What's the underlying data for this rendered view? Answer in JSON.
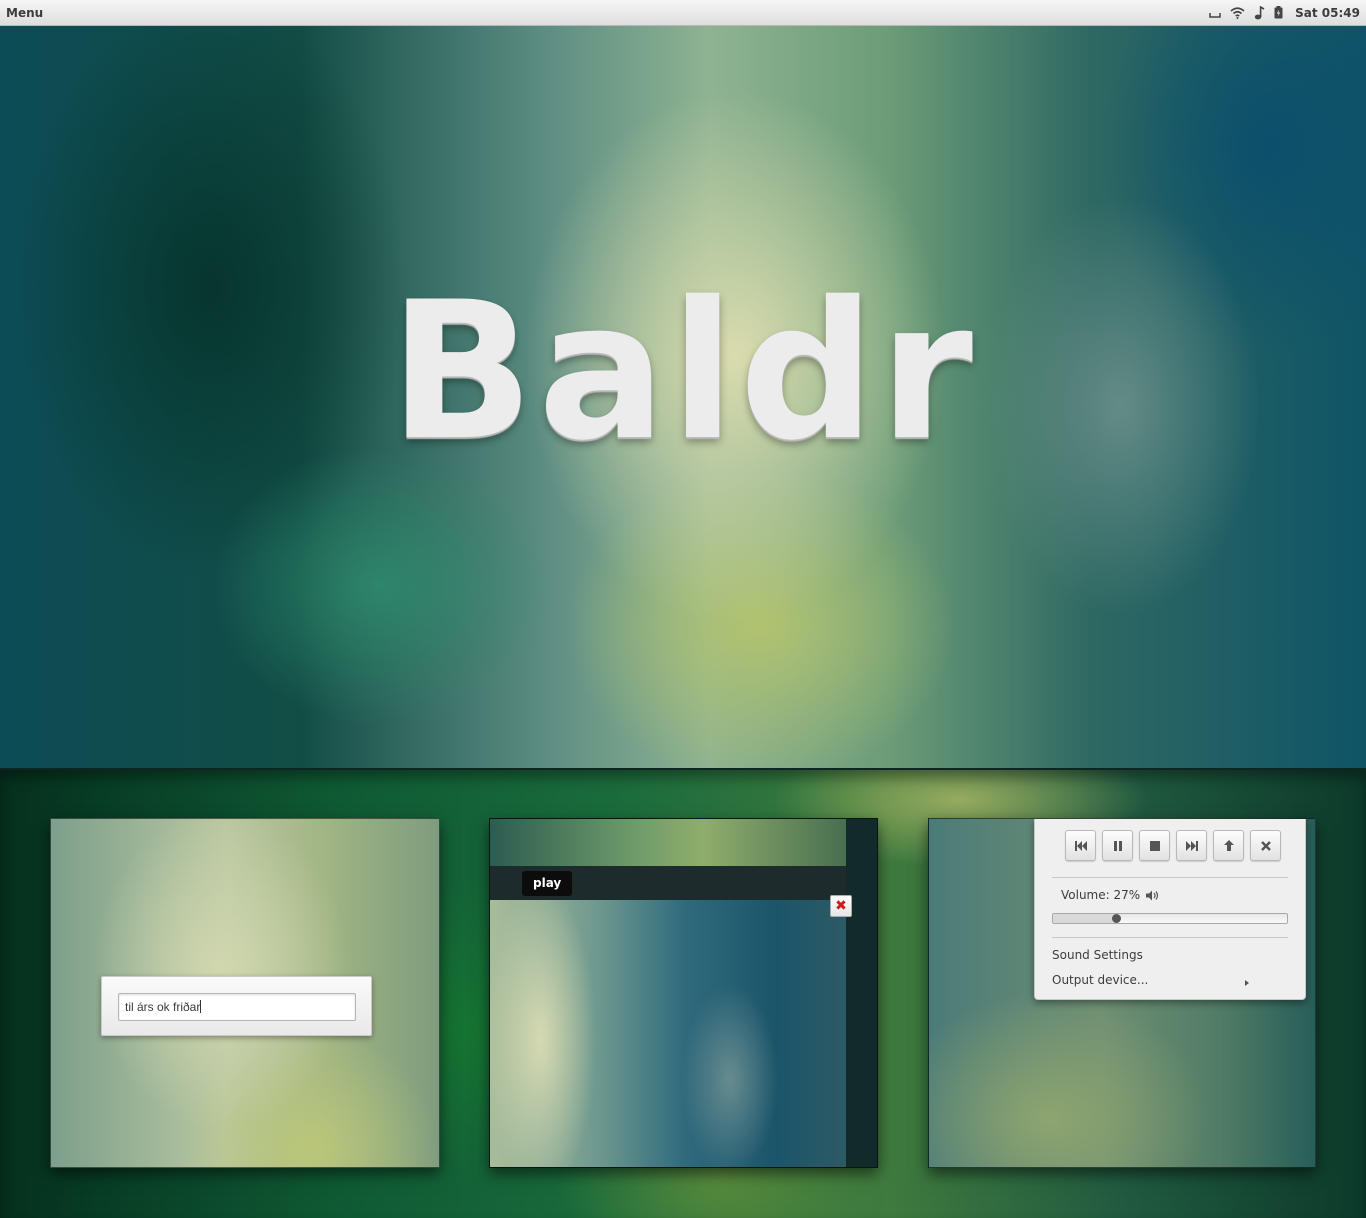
{
  "panel": {
    "menu_label": "Menu",
    "clock": "Sat 05:49",
    "tray_icons": [
      "keyboard-icon",
      "wifi-icon",
      "music-note-icon",
      "battery-icon"
    ]
  },
  "hero": {
    "title": "Baldr"
  },
  "thumb_dialog": {
    "input_value": "til árs ok friðar"
  },
  "thumb_player": {
    "play_label": "play",
    "close_glyph": "✖"
  },
  "sound_menu": {
    "buttons": [
      "previous-icon",
      "pause-icon",
      "stop-icon",
      "next-icon",
      "eject-icon",
      "close-icon"
    ],
    "volume_label": "Volume: 27%",
    "volume_level": 0.27,
    "sound_settings": "Sound Settings",
    "output_device": "Output device..."
  },
  "colors": {
    "panel_bg": "#e9e9e9",
    "close_red": "#d11c1c"
  }
}
